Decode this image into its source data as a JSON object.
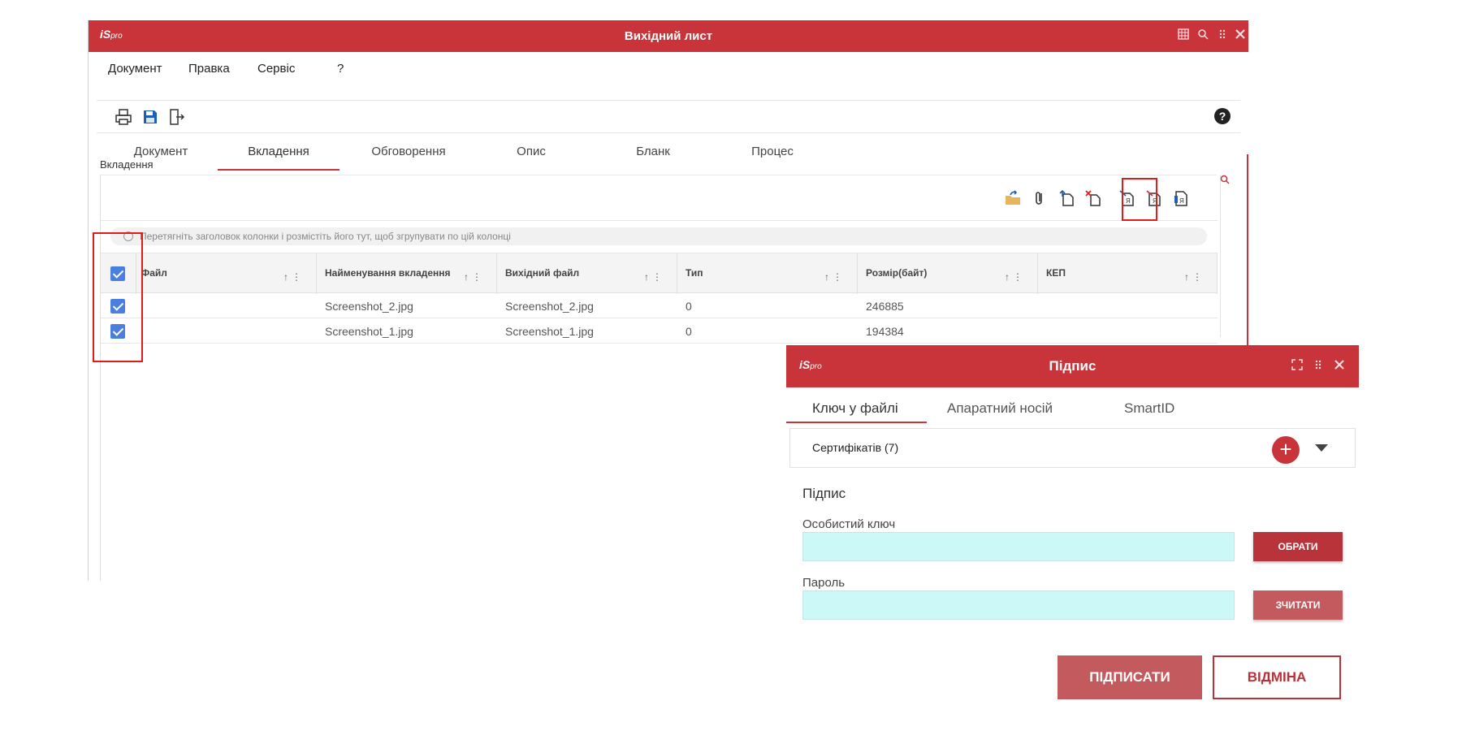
{
  "main_window": {
    "logo": "iS",
    "logo_suffix": "pro",
    "title": "Вихідний лист",
    "menu": [
      "Документ",
      "Правка",
      "Сервіс",
      "?"
    ],
    "tabs": [
      "Документ",
      "Вкладення",
      "Обговорення",
      "Опис",
      "Бланк",
      "Процес"
    ],
    "active_tab": "Вкладення",
    "section_label": "Вкладення",
    "group_hint": "Перетягніть заголовок колонки і розмістіть його тут, щоб згрупувати по цій колонці",
    "columns": [
      "Файл",
      "Найменування вкладення",
      "Вихідний файл",
      "Тип",
      "Розмір(байт)",
      "КЕП"
    ],
    "rows": [
      {
        "file": "",
        "name": "Screenshot_2.jpg",
        "source": "Screenshot_2.jpg",
        "type": "0",
        "size": "246885",
        "kep": ""
      },
      {
        "file": "",
        "name": "Screenshot_1.jpg",
        "source": "Screenshot_1.jpg",
        "type": "0",
        "size": "194384",
        "kep": ""
      }
    ],
    "help": "?"
  },
  "dialog": {
    "logo": "iS",
    "logo_suffix": "pro",
    "title": "Підпис",
    "tabs": [
      "Ключ у файлі",
      "Апаратний носій",
      "SmartID"
    ],
    "active_tab": "Ключ у файлі",
    "certificates": "Сертифікатів (7)",
    "add": "+",
    "section_title": "Підпис",
    "private_key_label": "Особистий ключ",
    "private_key_value": "",
    "choose_btn": "ОБРАТИ",
    "password_label": "Пароль",
    "password_value": "",
    "read_btn": "ЗЧИТАТИ",
    "sign_btn": "ПІДПИСАТИ",
    "cancel_btn": "ВІДМІНА"
  },
  "colors": {
    "brand_red": "#c9343a",
    "input_bg": "#cdf8f8",
    "checkbox_blue": "#4a7fe0",
    "highlight_red": "#e01b1b",
    "choose_btn": "#b8343a",
    "read_btn": "#c35a5e"
  }
}
